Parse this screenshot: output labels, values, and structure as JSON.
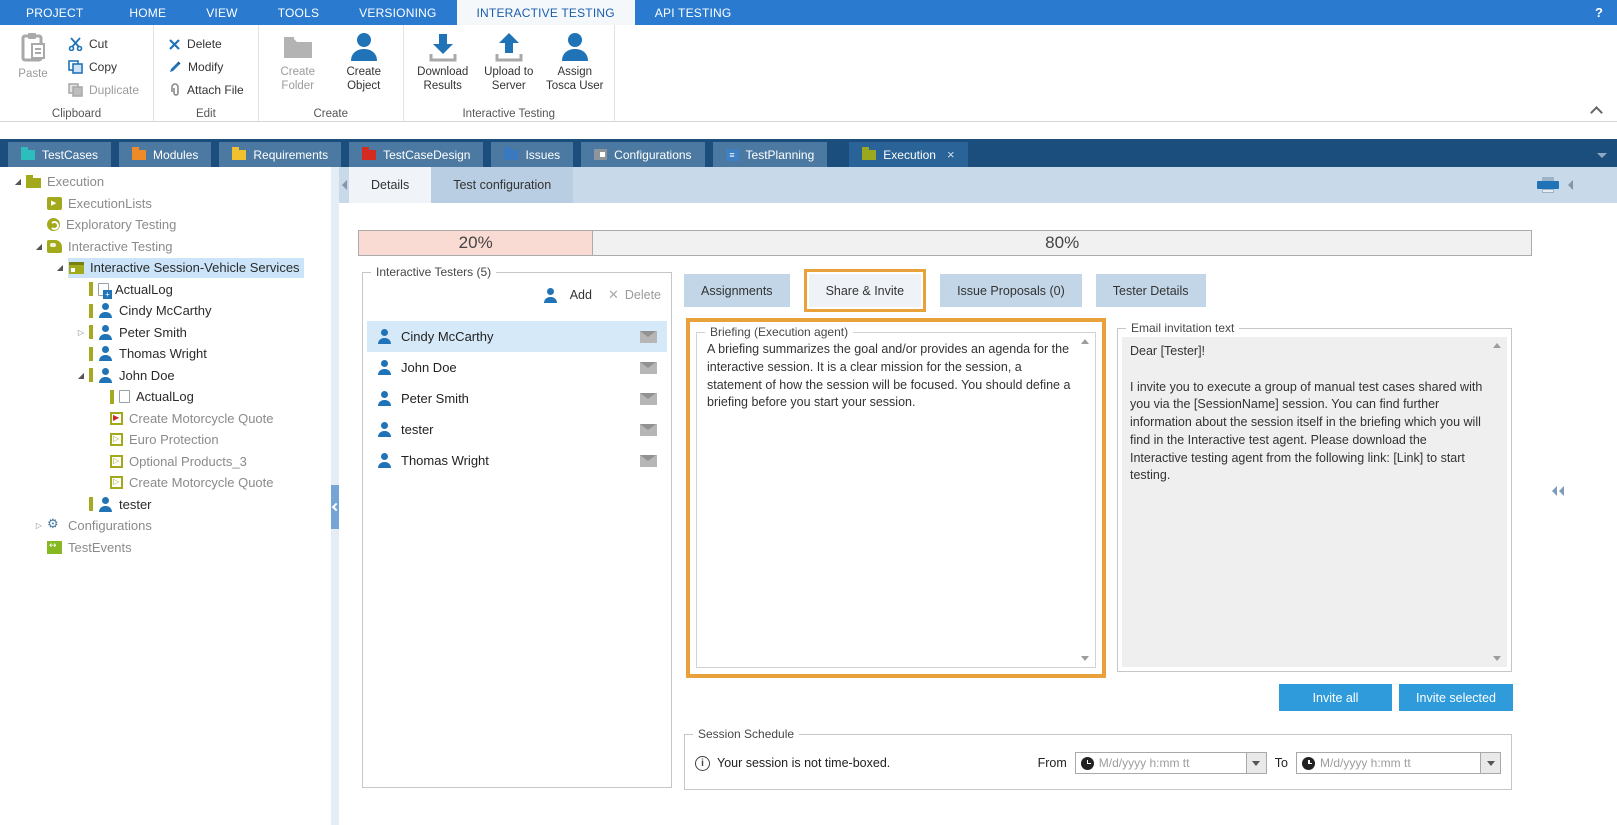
{
  "menubar": {
    "items": [
      {
        "label": "PROJECT"
      },
      {
        "label": "HOME"
      },
      {
        "label": "VIEW"
      },
      {
        "label": "TOOLS"
      },
      {
        "label": "VERSIONING"
      },
      {
        "label": "INTERACTIVE TESTING",
        "active": true
      },
      {
        "label": "API TESTING"
      }
    ],
    "help_icon": "?"
  },
  "ribbon": {
    "clipboard": {
      "group": "Clipboard",
      "paste": "Paste",
      "cut": "Cut",
      "copy": "Copy",
      "duplicate": "Duplicate"
    },
    "edit": {
      "group": "Edit",
      "delete_label": "Delete",
      "modify": "Modify",
      "attach": "Attach File"
    },
    "create": {
      "group": "Create",
      "create_folder": "Create Folder",
      "create_object": "Create Object"
    },
    "interactive": {
      "group": "Interactive Testing",
      "download": "Download Results",
      "upload": "Upload to Server",
      "assign": "Assign Tosca User"
    }
  },
  "workspace_tabs": {
    "items": [
      {
        "label": "TestCases"
      },
      {
        "label": "Modules"
      },
      {
        "label": "Requirements"
      },
      {
        "label": "TestCaseDesign"
      },
      {
        "label": "Issues"
      },
      {
        "label": "Configurations"
      },
      {
        "label": "TestPlanning"
      },
      {
        "label": "Execution",
        "active": true,
        "close": "×"
      }
    ]
  },
  "tree": {
    "items": [
      {
        "label": "Execution"
      },
      {
        "label": "ExecutionLists"
      },
      {
        "label": "Exploratory Testing"
      },
      {
        "label": "Interactive Testing"
      },
      {
        "label": "Interactive Session-Vehicle Services"
      },
      {
        "label": "ActualLog"
      },
      {
        "label": "Cindy McCarthy"
      },
      {
        "label": "Peter Smith"
      },
      {
        "label": "Thomas Wright"
      },
      {
        "label": "John Doe"
      },
      {
        "label": "ActualLog"
      },
      {
        "label": "Create Motorcycle Quote"
      },
      {
        "label": "Euro Protection"
      },
      {
        "label": "Optional Products_3"
      },
      {
        "label": "Create Motorcycle Quote"
      },
      {
        "label": "tester"
      },
      {
        "label": "Configurations"
      },
      {
        "label": "TestEvents"
      }
    ]
  },
  "detail_tabs": {
    "details": "Details",
    "test_configuration": "Test configuration"
  },
  "progress": {
    "left_label": "20%",
    "left_pct": 20,
    "left_color": "#fadbd3",
    "right_label": "80%",
    "right_pct": 80,
    "right_color": "#f1f1f1"
  },
  "testers": {
    "title": "Interactive Testers (5)",
    "add_label": "Add",
    "delete_label": "Delete",
    "rows": [
      {
        "name": "Cindy McCarthy",
        "selected": true
      },
      {
        "name": "John Doe"
      },
      {
        "name": "Peter Smith"
      },
      {
        "name": "tester"
      },
      {
        "name": "Thomas Wright"
      }
    ]
  },
  "share_tabs": {
    "assignments": "Assignments",
    "share_invite": "Share & Invite",
    "issue_proposals": "Issue Proposals (0)",
    "tester_details": "Tester Details"
  },
  "briefing": {
    "title": "Briefing (Execution agent)",
    "text": "A briefing summarizes the goal and/or provides an agenda for the interactive session. It is a clear mission for the session, a statement of how the session will be focused. You should define a briefing before you start your session."
  },
  "email": {
    "title": "Email invitation text",
    "text": "Dear [Tester]!\n\nI invite you to execute a group of manual test cases shared with you via the [SessionName] session. You can find further information about the session itself in the briefing which you will find in the Interactive test agent. Please download the Interactive testing agent from the following link: [Link] to start testing."
  },
  "invite": {
    "invite_all": "Invite all",
    "invite_selected": "Invite selected",
    "button_color": "#2f9bdb"
  },
  "schedule": {
    "title": "Session Schedule",
    "status": "Your session is not time-boxed.",
    "from_label": "From",
    "to_label": "To",
    "from_placeholder": "M/d/yyyy h:mm tt",
    "to_placeholder": "M/d/yyyy h:mm tt"
  },
  "accent": {
    "callout": "#e9a23b",
    "selection": "#cde6f7",
    "olive": "#a2aa1c",
    "blue": "#2173b8"
  }
}
